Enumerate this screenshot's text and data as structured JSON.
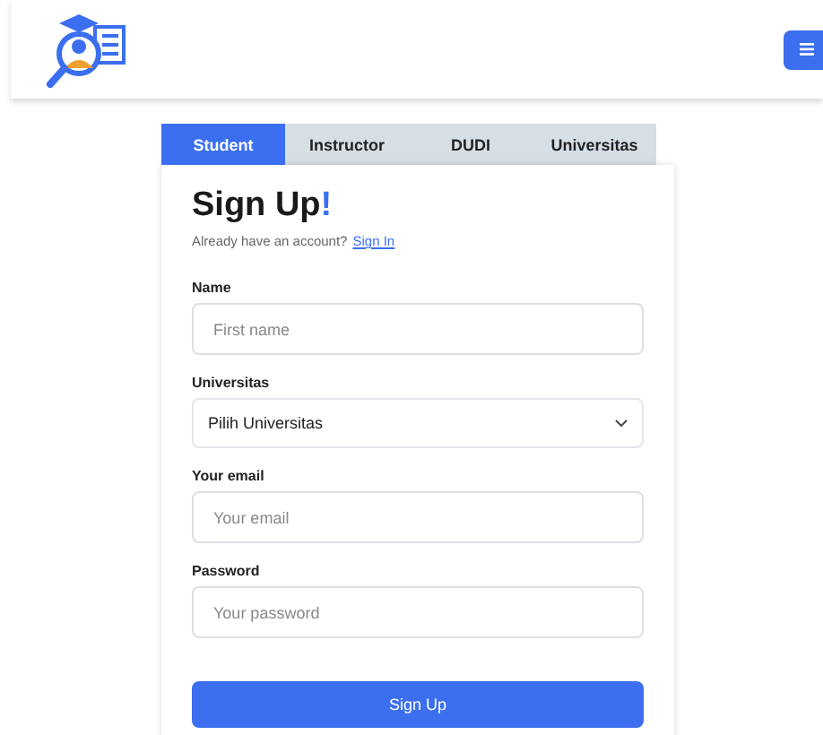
{
  "tabs": [
    {
      "label": "Student",
      "selected": true
    },
    {
      "label": "Instructor",
      "selected": false
    },
    {
      "label": "DUDI",
      "selected": false
    },
    {
      "label": "Universitas",
      "selected": false
    }
  ],
  "form": {
    "title": "Sign Up",
    "title_accent": "!",
    "subtitle": "Already have an account?",
    "signin_link": "Sign In",
    "fields": [
      {
        "kind": "input",
        "label": "Name",
        "placeholder": "First name"
      },
      {
        "kind": "select",
        "label": "Universitas",
        "value": "Pilih Universitas"
      },
      {
        "kind": "input",
        "label": "Your email",
        "placeholder": "Your email"
      },
      {
        "kind": "input",
        "label": "Password",
        "placeholder": "Your password"
      }
    ],
    "submit": "Sign Up"
  }
}
